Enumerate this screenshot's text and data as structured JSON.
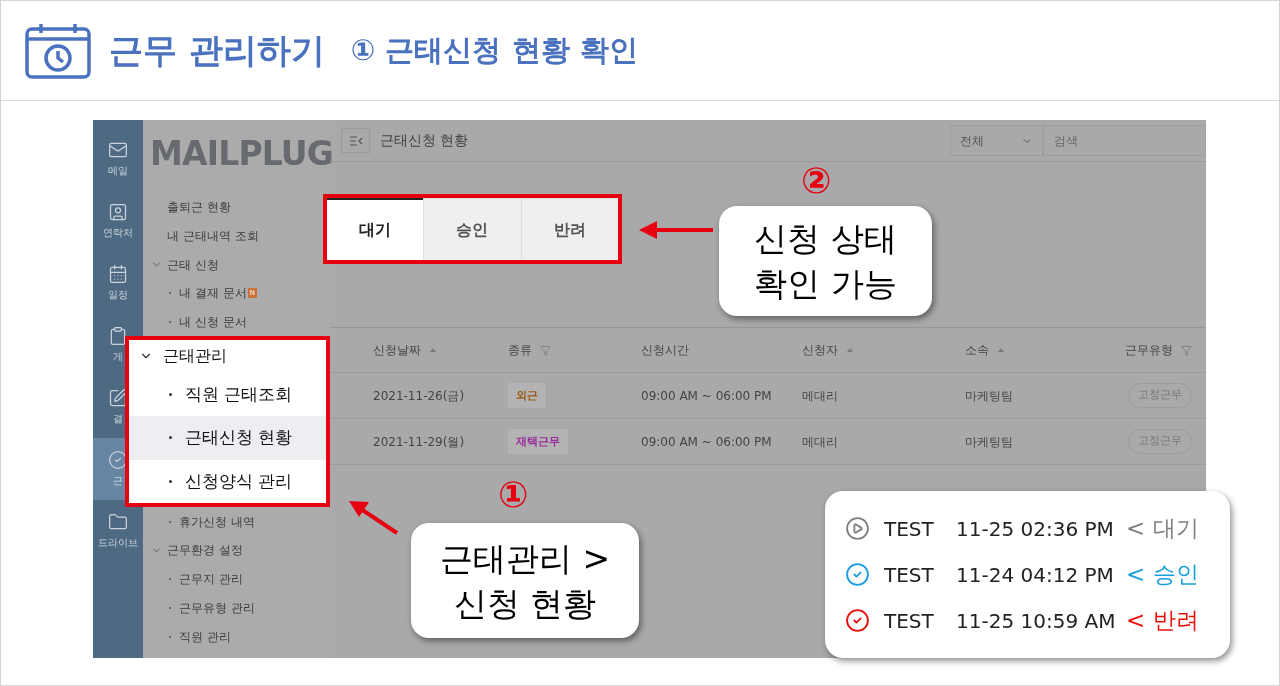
{
  "header": {
    "title": "근무 관리하기",
    "subtitle": "① 근태신청 현황 확인"
  },
  "app": {
    "rail": [
      {
        "label": "메일",
        "kind": "mail",
        "selected": false
      },
      {
        "label": "연락처",
        "kind": "contact",
        "selected": false
      },
      {
        "label": "일정",
        "kind": "calendar",
        "selected": false
      },
      {
        "label": "게",
        "kind": "board",
        "selected": false
      },
      {
        "label": "결",
        "kind": "approval",
        "selected": false
      },
      {
        "label": "근",
        "kind": "attendance",
        "selected": true
      },
      {
        "label": "드라이브",
        "kind": "drive",
        "selected": false
      }
    ],
    "logo": "MAILPLUG",
    "menu_top": [
      {
        "label": "출퇴근 현황",
        "kind": "link"
      },
      {
        "label": "내 근태내역 조회",
        "kind": "link"
      },
      {
        "label": "근태 신청",
        "kind": "group",
        "expanded": true
      },
      {
        "label": "내 결재 문서",
        "kind": "sub",
        "badge": "N"
      },
      {
        "label": "내 신청 문서",
        "kind": "sub"
      }
    ],
    "menu_bottom": [
      {
        "label": "휴가신청 내역",
        "kind": "sub"
      },
      {
        "label": "근무환경 설정",
        "kind": "group",
        "expanded": true
      },
      {
        "label": "근무지 관리",
        "kind": "sub"
      },
      {
        "label": "근무유형 관리",
        "kind": "sub"
      },
      {
        "label": "직원 관리",
        "kind": "sub"
      }
    ],
    "toolbar": {
      "title": "근태신청 현황",
      "filter": "전체",
      "search_placeholder": "검색"
    },
    "table": {
      "columns": [
        {
          "label": "신청날짜",
          "kind": "sort"
        },
        {
          "label": "종류",
          "kind": "filter"
        },
        {
          "label": "신청시간",
          "kind": "plain"
        },
        {
          "label": "신청자",
          "kind": "sort"
        },
        {
          "label": "소속",
          "kind": "sort"
        },
        {
          "label": "근무유형",
          "kind": "filter"
        }
      ],
      "rows": [
        {
          "date": "2021-11-26(금)",
          "type": "외근",
          "color": "#9a5a14",
          "time": "09:00 AM ~ 06:00 PM",
          "applicant": "메대리",
          "department": "마케팅팀",
          "work_type": "고정근무"
        },
        {
          "date": "2021-11-29(월)",
          "type": "재택근무",
          "color": "#9a2c9a",
          "time": "09:00 AM ~ 06:00 PM",
          "applicant": "메대리",
          "department": "마케팅팀",
          "work_type": "고정근무"
        }
      ]
    }
  },
  "highlight_menu": {
    "group": "근태관리",
    "expanded": true,
    "items": [
      {
        "label": "직원 근태조회",
        "selected": false
      },
      {
        "label": "근태신청 현황",
        "selected": true
      },
      {
        "label": "신청양식 관리",
        "selected": false
      }
    ]
  },
  "highlight_tabs": [
    {
      "label": "대기",
      "selected": true
    },
    {
      "label": "승인",
      "selected": false
    },
    {
      "label": "반려",
      "selected": false
    }
  ],
  "callouts": [
    {
      "marker": "②",
      "lines": [
        "신청 상태",
        "확인 가능"
      ]
    },
    {
      "marker": "①",
      "lines": [
        "근태관리 >",
        "신청 현황"
      ]
    }
  ],
  "legend": [
    {
      "kind": "pending",
      "name": "TEST",
      "time": "11-25 02:36 PM",
      "status": "< 대기",
      "color": "#808080"
    },
    {
      "kind": "approved",
      "name": "TEST",
      "time": "11-24 04:12 PM",
      "status": "< 승인",
      "color": "#1a9ee0"
    },
    {
      "kind": "rejected",
      "name": "TEST",
      "time": "11-25 10:59 AM",
      "status": "< 반려",
      "color": "#e8120c"
    }
  ]
}
